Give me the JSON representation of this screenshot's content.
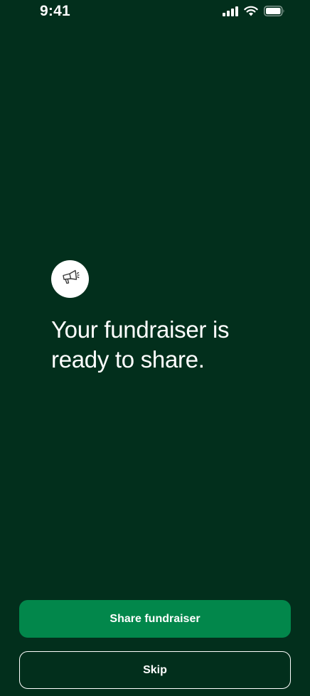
{
  "status_bar": {
    "time": "9:41",
    "icons": [
      "signal-icon",
      "wifi-icon",
      "battery-icon"
    ]
  },
  "hero": {
    "icon": "megaphone-icon",
    "title_line1": "Your fundraiser is",
    "title_line2": "ready to share."
  },
  "actions": {
    "primary_label": "Share fundraiser",
    "secondary_label": "Skip"
  },
  "colors": {
    "background": "#022f1c",
    "primary_button": "#02874b",
    "text": "#ffffff"
  }
}
